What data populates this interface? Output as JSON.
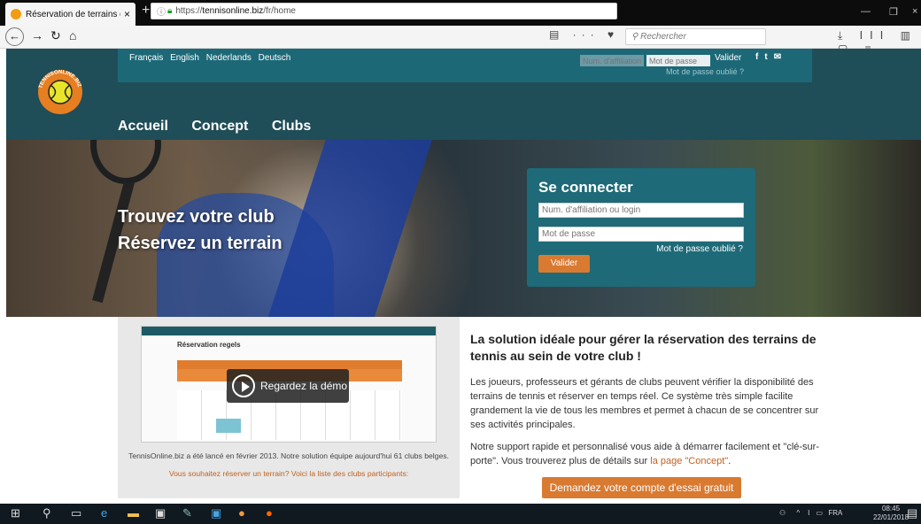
{
  "browser": {
    "tab_title": "Réservation de terrains de Tenn",
    "url_prefix": "https://",
    "url_host": "tennisonline.biz",
    "url_path": "/fr/home",
    "search_placeholder": "Rechercher",
    "new_tab": "+",
    "close_tab": "×"
  },
  "header": {
    "languages": [
      "Français",
      "English",
      "Nederlands",
      "Deutsch"
    ],
    "affiliation_placeholder": "Num. d'affiliation",
    "password_placeholder": "Mot de passe",
    "submit_label": "Valider",
    "forgot_label": "Mot de passe oublié ?",
    "social_icons": [
      "facebook-icon",
      "twitter-icon",
      "mail-icon"
    ],
    "logo_text": "TENNISONLINE.BIZ"
  },
  "nav": {
    "items": [
      "Accueil",
      "Concept",
      "Clubs"
    ]
  },
  "hero": {
    "line1": "Trouvez votre club",
    "line2": "Réservez un terrain"
  },
  "login": {
    "title": "Se connecter",
    "login_placeholder": "Num. d'affiliation ou login",
    "password_placeholder": "Mot de passe",
    "forgot_label": "Mot de passe oublié ?",
    "submit_label": "Valider"
  },
  "demo": {
    "screen_title": "Réservation regels",
    "play_label": "Regardez la démo",
    "caption": "TennisOnline.biz a été lancé en février 2013. Notre solution équipe aujourd'hui 61 clubs belges.",
    "link": "Vous souhaitez réserver un terrain? Voici la liste des clubs participants:"
  },
  "content": {
    "title": "La solution idéale pour gérer la réservation des terrains de tennis au sein de votre club !",
    "para1": "Les joueurs, professeurs et gérants de clubs peuvent vérifier la disponibilité des terrains de tennis et réserver en temps réel. Ce système très simple facilite grandement la vie de tous les membres et permet à chacun de se concentrer sur ses activités principales.",
    "para2_start": "Notre support rapide et personnalisé vous aide à démarrer facilement et \"clé-sur-porte\". Vous trouverez plus de détails sur ",
    "para2_link": "la page \"Concept\"",
    "para2_end": ".",
    "cta": "Demandez votre compte d'essai gratuit"
  },
  "taskbar": {
    "lang": "FRA",
    "time": "08:45",
    "date": "22/01/2018"
  },
  "colors": {
    "header_dark": "#1f4d58",
    "header_band": "#1c6877",
    "accent_orange": "#d97a31",
    "login_panel": "#1e6a78"
  }
}
